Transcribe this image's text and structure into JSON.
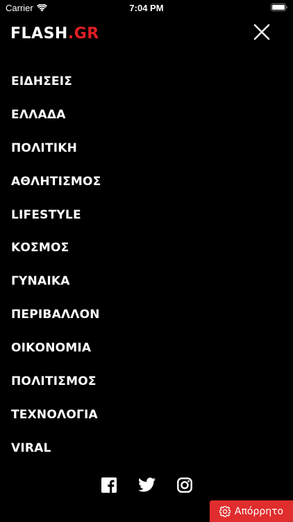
{
  "status_bar": {
    "carrier": "Carrier",
    "time": "7:04 PM",
    "wifi_icon": "wifi-icon",
    "battery_icon": "battery-icon"
  },
  "header": {
    "logo_main": "FLASH",
    "logo_suffix": ".GR",
    "logo_accent_color": "#e31e24",
    "close_icon": "close-icon"
  },
  "menu": {
    "items": [
      "ΕΙΔΗΣΕΙΣ",
      "ΕΛΛΑΔΑ",
      "ΠΟΛΙΤΙΚΗ",
      "ΑΘΛΗΤΙΣΜΟΣ",
      "LIFESTYLE",
      "ΚΟΣΜΟΣ",
      "ΓΥΝΑΙΚΑ",
      "ΠΕΡΙΒΑΛΛΟΝ",
      "ΟΙΚΟΝΟΜΙΑ",
      "ΠΟΛΙΤΙΣΜΟΣ",
      "ΤΕΧΝΟΛΟΓΙΑ",
      "VIRAL"
    ]
  },
  "social": {
    "icons": [
      "facebook-icon",
      "twitter-icon",
      "instagram-icon"
    ]
  },
  "privacy": {
    "label": "Απόρρητο",
    "icon": "gear-icon",
    "color": "#e02d2d"
  }
}
